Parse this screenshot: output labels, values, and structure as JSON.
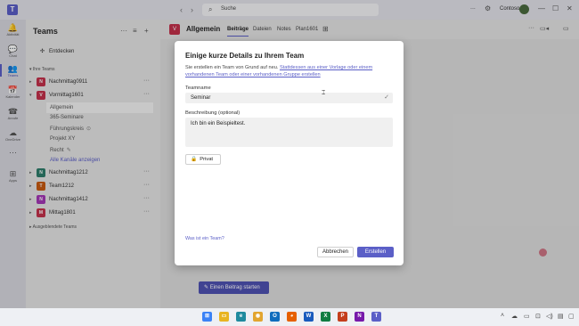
{
  "titlebar": {
    "search_placeholder": "Suche",
    "more": "...",
    "org": "Contoso"
  },
  "rail": [
    {
      "icon": "bell-icon",
      "glyph": "🔔",
      "label": "Aktivität"
    },
    {
      "icon": "chat-icon",
      "glyph": "💬",
      "label": "Chat"
    },
    {
      "icon": "teams-icon",
      "glyph": "👥",
      "label": "Teams",
      "active": true
    },
    {
      "icon": "calendar-icon",
      "glyph": "📅",
      "label": "Kalender"
    },
    {
      "icon": "phone-icon",
      "glyph": "☎",
      "label": "Anrufe"
    },
    {
      "icon": "cloud-icon",
      "glyph": "☁",
      "label": "OneDrive"
    },
    {
      "icon": "more-icon",
      "glyph": "···",
      "label": ""
    },
    {
      "icon": "apps-icon",
      "glyph": "⊞",
      "label": "Apps"
    }
  ],
  "panel": {
    "title": "Teams",
    "discover": "Entdecken",
    "my_teams": "Ihre Teams",
    "hidden_teams": "Ausgeblendete Teams",
    "teams": [
      {
        "name": "Nachmittag0911",
        "color": "#c4314b",
        "initial": "N"
      },
      {
        "name": "Vormittag1601",
        "color": "#c4314b",
        "initial": "V"
      },
      {
        "name": "Nachmittag1212",
        "color": "#2e7d6b",
        "initial": "N"
      },
      {
        "name": "Team1212",
        "color": "#c75b12",
        "initial": "T"
      },
      {
        "name": "Nachmittag1412",
        "color": "#a438b6",
        "initial": "N"
      },
      {
        "name": "Mittag1801",
        "color": "#c4314b",
        "initial": "M"
      }
    ],
    "channels": [
      {
        "name": "Allgemein"
      },
      {
        "name": "365-Seminare"
      },
      {
        "name": "Führungskreis",
        "suffix": "⊙"
      },
      {
        "name": "Projekt XY"
      },
      {
        "name": "Recht",
        "suffix": "✎"
      },
      {
        "name": "Alle Kanäle anzeigen"
      }
    ]
  },
  "main": {
    "channel_name": "Allgemein",
    "channel_initial": "V",
    "tabs": [
      "Beiträge",
      "Dateien",
      "Notes",
      "Plan1601"
    ],
    "new_post": "Einen Beitrag starten"
  },
  "dialog": {
    "title": "Einige kurze Details zu Ihrem Team",
    "subtitle_prefix": "Sie erstellen ein Team von Grund auf neu. ",
    "subtitle_link": "Stattdessen aus einer Vorlage oder einem vorhandenen Team oder einer vorhandenen Gruppe erstellen",
    "name_label": "Teamname",
    "name_value": "Seminar",
    "desc_label": "Beschreibung (optional)",
    "desc_value": "Ich bin ein Beispieltest.",
    "privacy": "Privat",
    "help_link": "Was ist ein Team?",
    "cancel": "Abbrechen",
    "create": "Erstellen"
  },
  "taskbar": {
    "apps": [
      {
        "name": "windows-start-icon",
        "color": "#3b82f6",
        "glyph": "⊞"
      },
      {
        "name": "file-explorer-icon",
        "color": "#e8b422",
        "glyph": "▭"
      },
      {
        "name": "edge-icon",
        "color": "#1f8a9e",
        "glyph": "e"
      },
      {
        "name": "chrome-icon",
        "color": "#e2a52f",
        "glyph": "◉"
      },
      {
        "name": "outlook-icon",
        "color": "#0f6cbd",
        "glyph": "O"
      },
      {
        "name": "firefox-icon",
        "color": "#e66000",
        "glyph": "◕"
      },
      {
        "name": "word-icon",
        "color": "#185abd",
        "glyph": "W"
      },
      {
        "name": "excel-icon",
        "color": "#107c41",
        "glyph": "X"
      },
      {
        "name": "powerpoint-icon",
        "color": "#c43e1c",
        "glyph": "P"
      },
      {
        "name": "onenote-icon",
        "color": "#7719aa",
        "glyph": "N"
      },
      {
        "name": "teams-taskbar-icon",
        "color": "#5b5fc7",
        "glyph": "T"
      }
    ]
  }
}
